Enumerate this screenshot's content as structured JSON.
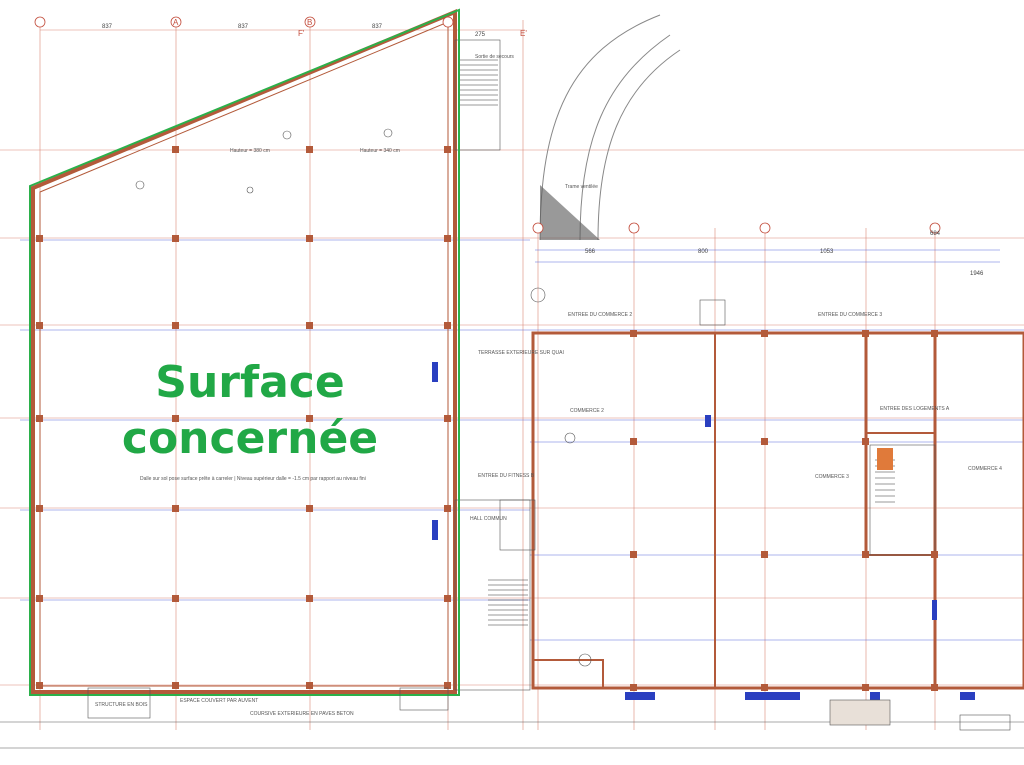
{
  "overlay": {
    "line1": "Surface",
    "line2": "concernée"
  },
  "axes": {
    "a1": "A",
    "a2": "B",
    "f_left": "F'",
    "e_right": "E'"
  },
  "dimensions": {
    "top_837_a": "837",
    "top_837_b": "837",
    "top_837_c": "837",
    "top_275": "275",
    "right_566": "566",
    "right_800": "800",
    "right_1053": "1053",
    "right_684": "684",
    "right_1946": "1946"
  },
  "room_labels": {
    "commerce_2": "COMMERCE 2",
    "commerce_3": "COMMERCE 3",
    "commerce_4": "COMMERCE 4",
    "entree_commerce_2": "ENTREE DU COMMERCE 2",
    "entree_commerce_3": "ENTREE DU COMMERCE 3",
    "entree_logements": "ENTREE DES LOGEMENTS A",
    "entree_fitness": "ENTREE DU FITNESS B",
    "hall_commun": "HALL COMMUN",
    "terrasse": "TERRASSE EXTERIEURE SUR QUAI",
    "espace_couvert": "ESPACE COUVERT PAR AUVENT",
    "structure_bois": "STRUCTURE EN BOIS",
    "coursive": "COURSIVE EXTERIEURE EN PAVES BETON",
    "sortie_secours": "Sortie de secours",
    "trame": "Trame ventilée"
  },
  "notes": {
    "dalle": "Dalle sur sol pose surface prête à carreler | Niveau supérieur dalle = -1.5 cm par rapport au niveau fini",
    "hauteur": "Hauteur = 380 cm",
    "plafond": "Hauteur = 340 cm"
  },
  "colors": {
    "boundary": "#2bb04a",
    "wall": "#b35a3a",
    "grid": "#d98878",
    "blue_lines": "#5a6cd9",
    "overlay_text": "#21a846",
    "blue_elements": "#2a3fc0"
  }
}
